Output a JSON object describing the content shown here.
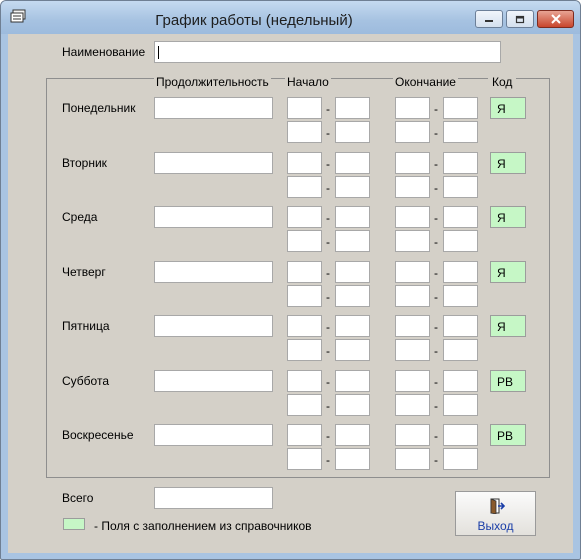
{
  "window": {
    "title": "График работы (недельный)",
    "controls": {
      "minimize": "minimize",
      "maximize": "maximize",
      "close": "close"
    }
  },
  "form": {
    "name_label": "Наименование",
    "name_value": "",
    "columns": {
      "duration": "Продолжительность",
      "start": "Начало",
      "end": "Окончание",
      "code": "Код"
    },
    "dash": "-",
    "days": [
      {
        "label": "Понедельник",
        "code": "Я"
      },
      {
        "label": "Вторник",
        "code": "Я"
      },
      {
        "label": "Среда",
        "code": "Я"
      },
      {
        "label": "Четверг",
        "code": "Я"
      },
      {
        "label": "Пятница",
        "code": "Я"
      },
      {
        "label": "Суббота",
        "code": "РВ"
      },
      {
        "label": "Воскресенье",
        "code": "РВ"
      }
    ],
    "total_label": "Всего",
    "total_value": "",
    "legend_text": "-  Поля с заполнением из справочников",
    "exit_label": "Выход"
  },
  "colors": {
    "dictionary_field": "#c6f7c6",
    "window_bg": "#d4d0c8",
    "exit_label": "#1a3ea8"
  },
  "icons": {
    "app": "form-icon",
    "exit": "exit-door-icon"
  }
}
